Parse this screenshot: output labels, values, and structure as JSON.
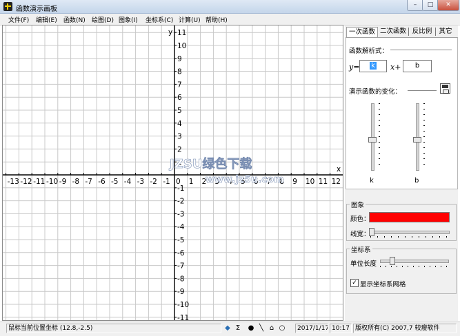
{
  "window": {
    "title": "函数演示画板",
    "minimize": "–",
    "maximize": "□",
    "close": "✕"
  },
  "menu": [
    "文件(F)",
    "编辑(E)",
    "函数(N)",
    "绘图(D)",
    "图象(I)",
    "坐标系(C)",
    "计算(U)",
    "帮助(H)"
  ],
  "graph": {
    "x_axis_label": "x",
    "y_axis_label": "y",
    "x_ticks": [
      "-13",
      "-12",
      "-11",
      "-10",
      "-9",
      "-8",
      "-7",
      "-6",
      "-5",
      "-4",
      "-3",
      "-2",
      "-1",
      "0",
      "1",
      "2",
      "3",
      "4",
      "5",
      "6",
      "7",
      "8",
      "9",
      "10",
      "11",
      "12"
    ],
    "y_ticks": [
      "11",
      "10",
      "9",
      "8",
      "7",
      "6",
      "5",
      "4",
      "3",
      "2",
      "1",
      "-1",
      "-2",
      "-3",
      "-4",
      "-5",
      "-6",
      "-7",
      "-8",
      "-9",
      "-10",
      "-11"
    ],
    "x_range": [
      -13,
      12
    ],
    "y_range": [
      -11,
      11
    ],
    "grid": true,
    "watermark_top": "JZSU绿色下载",
    "watermark_bottom": "www.jz5u.com"
  },
  "tabs": [
    "一次函数",
    "二次函数",
    "反比例",
    "其它"
  ],
  "linear": {
    "expr_header": "函数解析式：",
    "y_prefix": "y=",
    "k_value": "k",
    "x_plus": "x+",
    "b_value": "b",
    "demo_label": "演示函数的变化：",
    "slider_k_label": "k",
    "slider_b_label": "b"
  },
  "image_group": {
    "title": "图象",
    "color_label": "颜色：",
    "color_value": "#ff0000",
    "width_label": "线宽："
  },
  "axes_group": {
    "title": "坐标系",
    "unit_label": "单位长度",
    "show_grid_label": "显示坐标系网格",
    "show_grid_checked": true
  },
  "status": {
    "mouse_coord": "鼠标当前位置坐标 (12.8,-2.5)",
    "date": "2017/1/17",
    "time": "10:17",
    "copyright": "版权所有(C) 2007,7 较瘦软件"
  },
  "colors": {
    "grid": "#c8c8c8",
    "axis": "#000000",
    "line_color": "#ff0000",
    "panel_bg": "#f0f0f0"
  }
}
